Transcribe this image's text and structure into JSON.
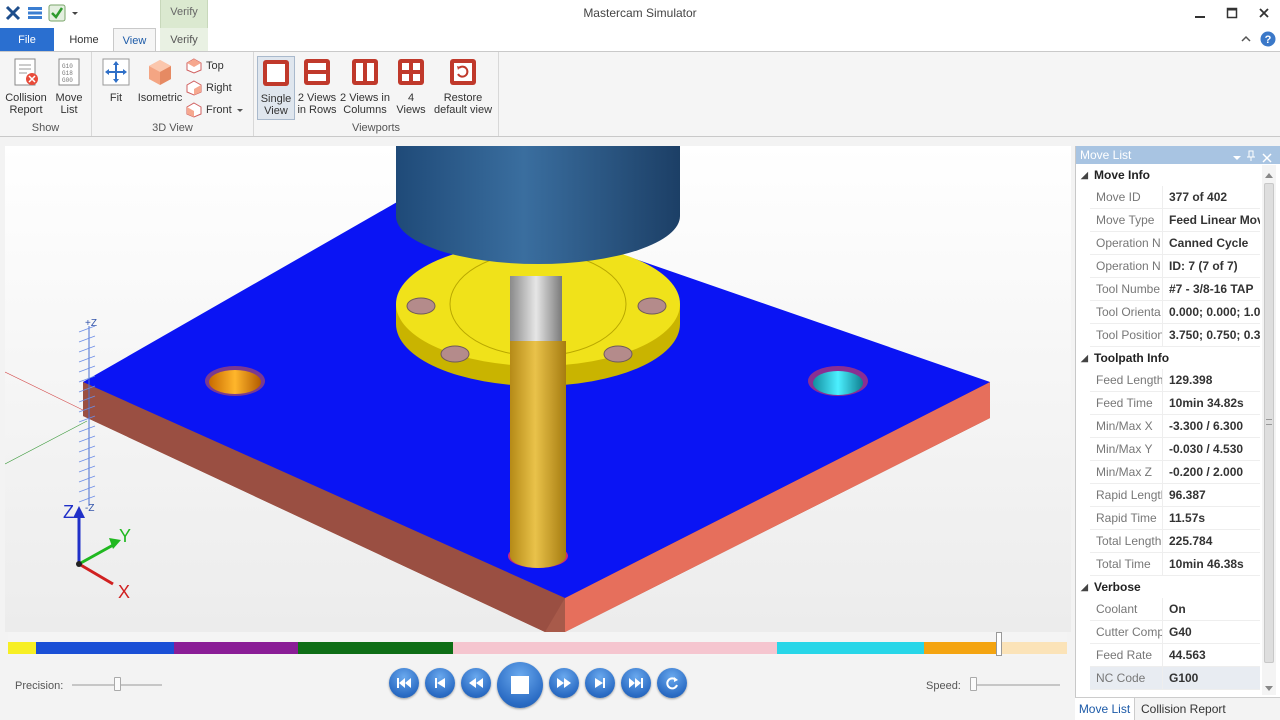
{
  "window": {
    "title": "Mastercam Simulator",
    "context_tab": "Verify"
  },
  "tabs": {
    "file": "File",
    "home": "Home",
    "view": "View",
    "verify": "Verify"
  },
  "ribbon": {
    "show": {
      "label": "Show",
      "collision_report": [
        "Collision",
        "Report"
      ],
      "move_list": [
        "Move",
        "List"
      ]
    },
    "view3d": {
      "label": "3D View",
      "fit": "Fit",
      "isometric": "Isometric",
      "top": "Top",
      "right": "Right",
      "front": "Front"
    },
    "viewports": {
      "label": "Viewports",
      "single": [
        "Single",
        "View"
      ],
      "rows": [
        "2 Views",
        "in Rows"
      ],
      "columns": [
        "2 Views in",
        "Columns"
      ],
      "four": [
        "4",
        "Views"
      ],
      "restore": [
        "Restore",
        "default view"
      ]
    }
  },
  "axis_labels": {
    "plus_z": "+Z",
    "minus_z": "-Z",
    "z": "Z",
    "y": "Y",
    "x": "X"
  },
  "controls": {
    "precision_label": "Precision:",
    "speed_label": "Speed:"
  },
  "panel": {
    "title": "Move List",
    "sections": [
      {
        "title": "Move Info",
        "rows": [
          {
            "key": "Move ID",
            "value": "377 of 402"
          },
          {
            "key": "Move Type",
            "value": "Feed Linear Mov"
          },
          {
            "key": "Operation N",
            "value": "Canned Cycle"
          },
          {
            "key": "Operation N",
            "value": "ID: 7 (7 of 7)"
          },
          {
            "key": "Tool Numbe",
            "value": "#7 - 3/8-16 TAP"
          },
          {
            "key": "Tool Orienta",
            "value": "0.000; 0.000; 1.0"
          },
          {
            "key": "Tool Position",
            "value": "3.750; 0.750; 0.3"
          }
        ]
      },
      {
        "title": "Toolpath Info",
        "rows": [
          {
            "key": "Feed Length",
            "value": "129.398"
          },
          {
            "key": "Feed Time",
            "value": "10min 34.82s"
          },
          {
            "key": "Min/Max X",
            "value": "-3.300 / 6.300"
          },
          {
            "key": "Min/Max Y",
            "value": "-0.030 / 4.530"
          },
          {
            "key": "Min/Max Z",
            "value": "-0.200 / 2.000"
          },
          {
            "key": "Rapid Lengtl",
            "value": "96.387"
          },
          {
            "key": "Rapid Time",
            "value": "11.57s"
          },
          {
            "key": "Total Length",
            "value": "225.784"
          },
          {
            "key": "Total Time",
            "value": "10min 46.38s"
          }
        ]
      },
      {
        "title": "Verbose",
        "rows": [
          {
            "key": "Coolant",
            "value": "On"
          },
          {
            "key": "Cutter Comp",
            "value": "G40"
          },
          {
            "key": "Feed Rate",
            "value": "44.563"
          },
          {
            "key": "NC Code",
            "value": "G100"
          }
        ]
      }
    ],
    "bottom_tabs": [
      "Move List",
      "Collision Report"
    ]
  },
  "timeline": {
    "segments": [
      {
        "color": "#f7ef24",
        "start": 0.0,
        "end": 0.026
      },
      {
        "color": "#1a4fd6",
        "start": 0.026,
        "end": 0.157
      },
      {
        "color": "#8a1d96",
        "start": 0.157,
        "end": 0.274
      },
      {
        "color": "#0e6e16",
        "start": 0.274,
        "end": 0.42
      },
      {
        "color": "#f5c5cf",
        "start": 0.42,
        "end": 0.726
      },
      {
        "color": "#27d6e8",
        "start": 0.726,
        "end": 0.865
      },
      {
        "color": "#f4a410",
        "start": 0.865,
        "end": 0.936
      },
      {
        "color": "#fbe3b8",
        "start": 0.936,
        "end": 1.0
      }
    ],
    "position": 0.936
  }
}
